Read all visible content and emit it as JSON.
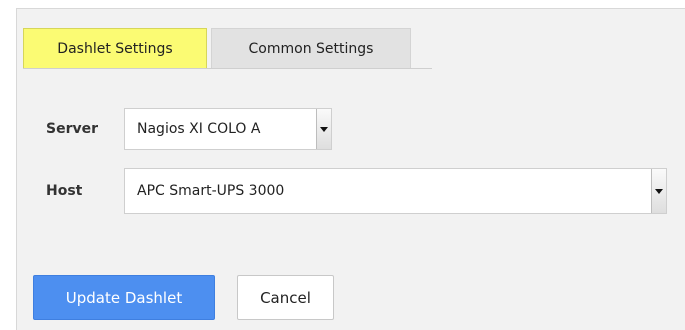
{
  "tabs": [
    {
      "label": "Dashlet Settings",
      "active": true
    },
    {
      "label": "Common Settings",
      "active": false
    }
  ],
  "form": {
    "server_label": "Server",
    "server_value": "Nagios XI COLO A",
    "host_label": "Host",
    "host_value": "APC Smart-UPS 3000"
  },
  "buttons": {
    "update_label": "Update Dashlet",
    "cancel_label": "Cancel"
  },
  "colors": {
    "active_tab": "#fbfb73",
    "primary_button": "#4d8ff0",
    "panel_background": "#f2f2f2"
  }
}
